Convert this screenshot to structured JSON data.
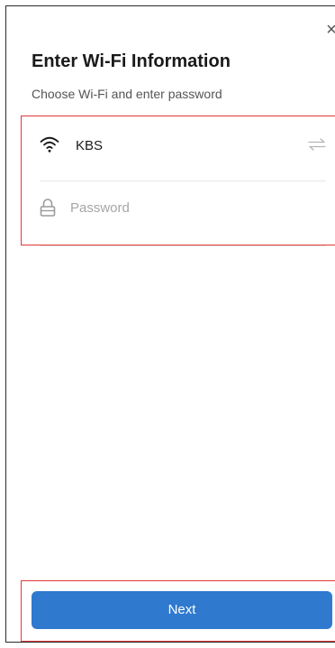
{
  "header": {
    "close_glyph": "×",
    "title": "Enter Wi-Fi Information",
    "subtitle": "Choose Wi-Fi and enter password"
  },
  "wifi": {
    "icon": "wifi-icon",
    "ssid": "KBS",
    "switch_icon": "switch-network-icon"
  },
  "password": {
    "icon": "lock-icon",
    "placeholder": "Password",
    "value": ""
  },
  "footer": {
    "next_label": "Next"
  },
  "colors": {
    "accent": "#2f79cf",
    "highlight_border": "#e0383a",
    "divider": "#e6e6e6",
    "placeholder": "#a6a6a6"
  }
}
